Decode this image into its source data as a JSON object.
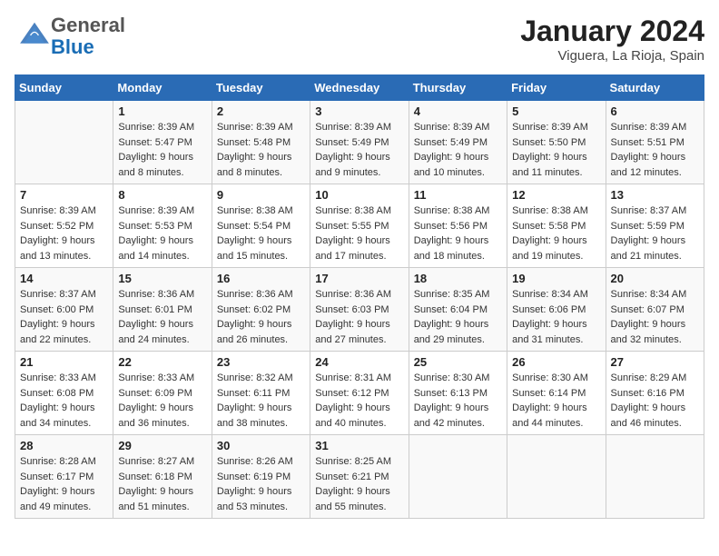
{
  "logo": {
    "general": "General",
    "blue": "Blue"
  },
  "title": "January 2024",
  "location": "Viguera, La Rioja, Spain",
  "days_of_week": [
    "Sunday",
    "Monday",
    "Tuesday",
    "Wednesday",
    "Thursday",
    "Friday",
    "Saturday"
  ],
  "weeks": [
    [
      {
        "num": "",
        "sunrise": "",
        "sunset": "",
        "daylight": ""
      },
      {
        "num": "1",
        "sunrise": "Sunrise: 8:39 AM",
        "sunset": "Sunset: 5:47 PM",
        "daylight": "Daylight: 9 hours and 8 minutes."
      },
      {
        "num": "2",
        "sunrise": "Sunrise: 8:39 AM",
        "sunset": "Sunset: 5:48 PM",
        "daylight": "Daylight: 9 hours and 8 minutes."
      },
      {
        "num": "3",
        "sunrise": "Sunrise: 8:39 AM",
        "sunset": "Sunset: 5:49 PM",
        "daylight": "Daylight: 9 hours and 9 minutes."
      },
      {
        "num": "4",
        "sunrise": "Sunrise: 8:39 AM",
        "sunset": "Sunset: 5:49 PM",
        "daylight": "Daylight: 9 hours and 10 minutes."
      },
      {
        "num": "5",
        "sunrise": "Sunrise: 8:39 AM",
        "sunset": "Sunset: 5:50 PM",
        "daylight": "Daylight: 9 hours and 11 minutes."
      },
      {
        "num": "6",
        "sunrise": "Sunrise: 8:39 AM",
        "sunset": "Sunset: 5:51 PM",
        "daylight": "Daylight: 9 hours and 12 minutes."
      }
    ],
    [
      {
        "num": "7",
        "sunrise": "Sunrise: 8:39 AM",
        "sunset": "Sunset: 5:52 PM",
        "daylight": "Daylight: 9 hours and 13 minutes."
      },
      {
        "num": "8",
        "sunrise": "Sunrise: 8:39 AM",
        "sunset": "Sunset: 5:53 PM",
        "daylight": "Daylight: 9 hours and 14 minutes."
      },
      {
        "num": "9",
        "sunrise": "Sunrise: 8:38 AM",
        "sunset": "Sunset: 5:54 PM",
        "daylight": "Daylight: 9 hours and 15 minutes."
      },
      {
        "num": "10",
        "sunrise": "Sunrise: 8:38 AM",
        "sunset": "Sunset: 5:55 PM",
        "daylight": "Daylight: 9 hours and 17 minutes."
      },
      {
        "num": "11",
        "sunrise": "Sunrise: 8:38 AM",
        "sunset": "Sunset: 5:56 PM",
        "daylight": "Daylight: 9 hours and 18 minutes."
      },
      {
        "num": "12",
        "sunrise": "Sunrise: 8:38 AM",
        "sunset": "Sunset: 5:58 PM",
        "daylight": "Daylight: 9 hours and 19 minutes."
      },
      {
        "num": "13",
        "sunrise": "Sunrise: 8:37 AM",
        "sunset": "Sunset: 5:59 PM",
        "daylight": "Daylight: 9 hours and 21 minutes."
      }
    ],
    [
      {
        "num": "14",
        "sunrise": "Sunrise: 8:37 AM",
        "sunset": "Sunset: 6:00 PM",
        "daylight": "Daylight: 9 hours and 22 minutes."
      },
      {
        "num": "15",
        "sunrise": "Sunrise: 8:36 AM",
        "sunset": "Sunset: 6:01 PM",
        "daylight": "Daylight: 9 hours and 24 minutes."
      },
      {
        "num": "16",
        "sunrise": "Sunrise: 8:36 AM",
        "sunset": "Sunset: 6:02 PM",
        "daylight": "Daylight: 9 hours and 26 minutes."
      },
      {
        "num": "17",
        "sunrise": "Sunrise: 8:36 AM",
        "sunset": "Sunset: 6:03 PM",
        "daylight": "Daylight: 9 hours and 27 minutes."
      },
      {
        "num": "18",
        "sunrise": "Sunrise: 8:35 AM",
        "sunset": "Sunset: 6:04 PM",
        "daylight": "Daylight: 9 hours and 29 minutes."
      },
      {
        "num": "19",
        "sunrise": "Sunrise: 8:34 AM",
        "sunset": "Sunset: 6:06 PM",
        "daylight": "Daylight: 9 hours and 31 minutes."
      },
      {
        "num": "20",
        "sunrise": "Sunrise: 8:34 AM",
        "sunset": "Sunset: 6:07 PM",
        "daylight": "Daylight: 9 hours and 32 minutes."
      }
    ],
    [
      {
        "num": "21",
        "sunrise": "Sunrise: 8:33 AM",
        "sunset": "Sunset: 6:08 PM",
        "daylight": "Daylight: 9 hours and 34 minutes."
      },
      {
        "num": "22",
        "sunrise": "Sunrise: 8:33 AM",
        "sunset": "Sunset: 6:09 PM",
        "daylight": "Daylight: 9 hours and 36 minutes."
      },
      {
        "num": "23",
        "sunrise": "Sunrise: 8:32 AM",
        "sunset": "Sunset: 6:11 PM",
        "daylight": "Daylight: 9 hours and 38 minutes."
      },
      {
        "num": "24",
        "sunrise": "Sunrise: 8:31 AM",
        "sunset": "Sunset: 6:12 PM",
        "daylight": "Daylight: 9 hours and 40 minutes."
      },
      {
        "num": "25",
        "sunrise": "Sunrise: 8:30 AM",
        "sunset": "Sunset: 6:13 PM",
        "daylight": "Daylight: 9 hours and 42 minutes."
      },
      {
        "num": "26",
        "sunrise": "Sunrise: 8:30 AM",
        "sunset": "Sunset: 6:14 PM",
        "daylight": "Daylight: 9 hours and 44 minutes."
      },
      {
        "num": "27",
        "sunrise": "Sunrise: 8:29 AM",
        "sunset": "Sunset: 6:16 PM",
        "daylight": "Daylight: 9 hours and 46 minutes."
      }
    ],
    [
      {
        "num": "28",
        "sunrise": "Sunrise: 8:28 AM",
        "sunset": "Sunset: 6:17 PM",
        "daylight": "Daylight: 9 hours and 49 minutes."
      },
      {
        "num": "29",
        "sunrise": "Sunrise: 8:27 AM",
        "sunset": "Sunset: 6:18 PM",
        "daylight": "Daylight: 9 hours and 51 minutes."
      },
      {
        "num": "30",
        "sunrise": "Sunrise: 8:26 AM",
        "sunset": "Sunset: 6:19 PM",
        "daylight": "Daylight: 9 hours and 53 minutes."
      },
      {
        "num": "31",
        "sunrise": "Sunrise: 8:25 AM",
        "sunset": "Sunset: 6:21 PM",
        "daylight": "Daylight: 9 hours and 55 minutes."
      },
      {
        "num": "",
        "sunrise": "",
        "sunset": "",
        "daylight": ""
      },
      {
        "num": "",
        "sunrise": "",
        "sunset": "",
        "daylight": ""
      },
      {
        "num": "",
        "sunrise": "",
        "sunset": "",
        "daylight": ""
      }
    ]
  ]
}
